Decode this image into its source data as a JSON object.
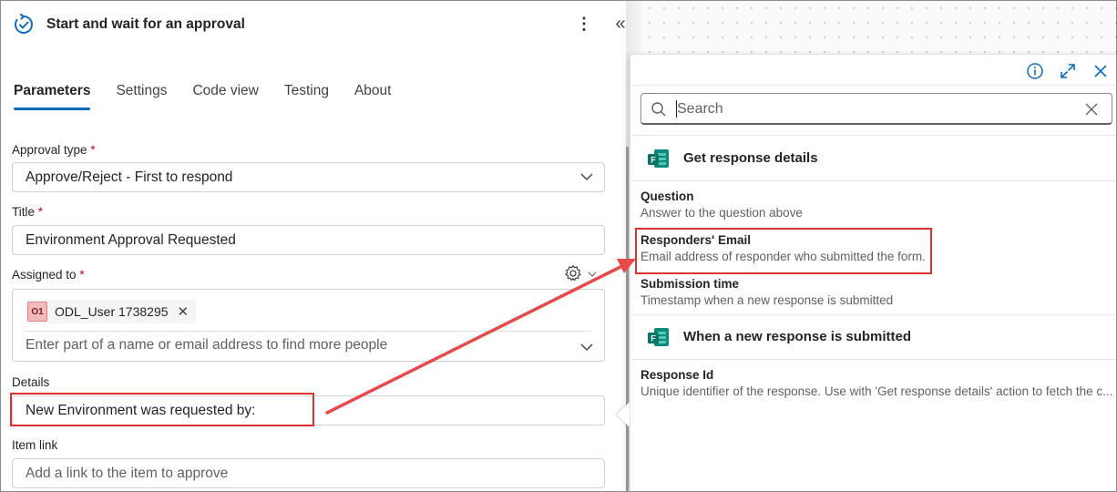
{
  "panel": {
    "title": "Start and wait for an approval",
    "more_glyph": "⋮",
    "collapse_glyph": "«",
    "tabs": [
      {
        "label": "Parameters",
        "active": true
      },
      {
        "label": "Settings",
        "active": false
      },
      {
        "label": "Code view",
        "active": false
      },
      {
        "label": "Testing",
        "active": false
      },
      {
        "label": "About",
        "active": false
      }
    ],
    "fields": {
      "approval_type": {
        "label": "Approval type",
        "required": "*",
        "value": "Approve/Reject - First to respond"
      },
      "title": {
        "label": "Title",
        "required": "*",
        "value": "Environment Approval Requested"
      },
      "assigned_to": {
        "label": "Assigned to",
        "required": "*",
        "chip": {
          "initials": "O1",
          "name": "ODL_User 1738295"
        },
        "placeholder": "Enter part of a name or email address to find more people"
      },
      "details": {
        "label": "Details",
        "value": "New Environment was requested by:"
      },
      "item_link": {
        "label": "Item link",
        "placeholder": "Add a link to the item to approve"
      }
    }
  },
  "dynamic_content": {
    "search_placeholder": "Search",
    "groups": [
      {
        "name": "Get response details",
        "icon": "forms-icon",
        "items": [
          {
            "name": "Question",
            "description": "Answer to the question above"
          },
          {
            "name": "Responders' Email",
            "description": "Email address of responder who submitted the form."
          },
          {
            "name": "Submission time",
            "description": "Timestamp when a new response is submitted"
          }
        ]
      },
      {
        "name": "When a new response is submitted",
        "icon": "forms-icon",
        "items": [
          {
            "name": "Response Id",
            "description": "Unique identifier of the response. Use with 'Get response details' action to fetch the c..."
          }
        ]
      }
    ]
  },
  "colors": {
    "accent": "#0f6cbd",
    "annotation_red": "#e03131",
    "required": "#c50f1f",
    "forms_green": "#077568"
  }
}
